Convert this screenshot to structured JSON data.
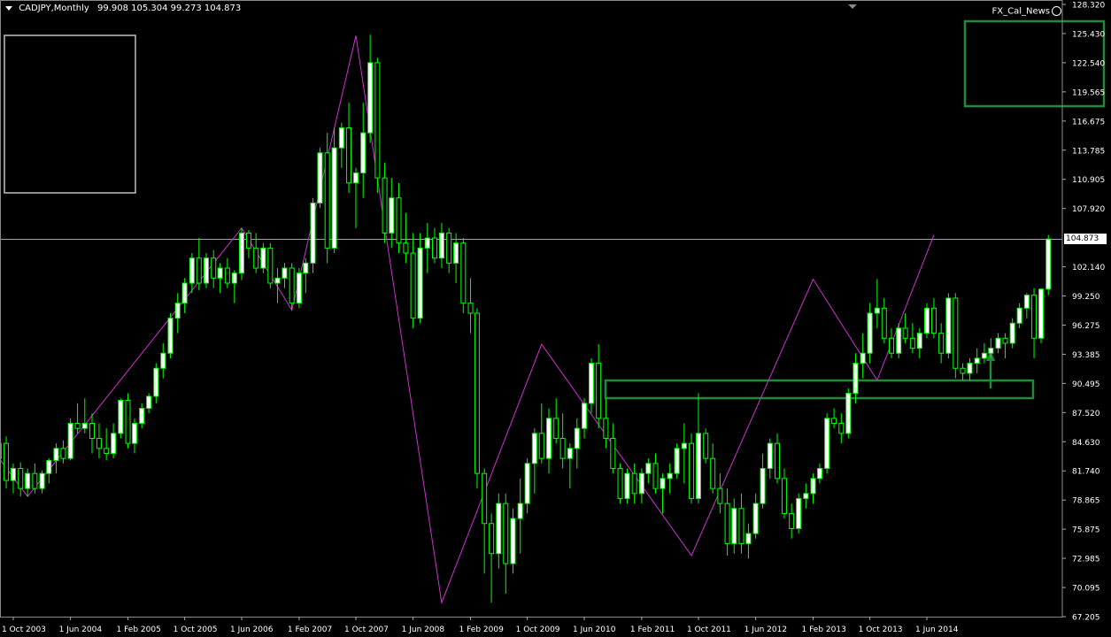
{
  "header": {
    "symbol": "CADJPY,Monthly",
    "ohlc": "99.908 105.304 99.273 104.873"
  },
  "indicator_label": "FX_Cal_News",
  "current_price_label": "104.873",
  "colors": {
    "background": "#000000",
    "candle_up_fill": "#ffffff",
    "candle_wick": "#00ff00",
    "zigzag": "#cc33cc",
    "annotation": "#1f8a3c",
    "axis_text": "#ffffff",
    "grid_line": "#a0a0b0"
  },
  "chart_data": {
    "type": "candlestick",
    "ylim": [
      67.205,
      128.32
    ],
    "y_ticks": [
      "128.320",
      "125.430",
      "122.540",
      "119.565",
      "116.675",
      "113.785",
      "110.905",
      "107.920",
      "104.873",
      "102.140",
      "99.250",
      "96.275",
      "93.385",
      "90.495",
      "87.520",
      "84.630",
      "81.740",
      "78.865",
      "75.875",
      "72.985",
      "70.095",
      "67.205"
    ],
    "x_ticks": [
      "1 Oct 2003",
      "1 Jun 2004",
      "1 Feb 2005",
      "1 Oct 2005",
      "1 Jun 2006",
      "1 Feb 2007",
      "1 Oct 2007",
      "1 Jun 2008",
      "1 Feb 2009",
      "1 Oct 2009",
      "1 Jun 2010",
      "1 Feb 2011",
      "1 Oct 2011",
      "1 Jun 2012",
      "1 Feb 2013",
      "1 Oct 2013",
      "1 Jun 2014"
    ],
    "current_price": 104.873,
    "zigzag": [
      [
        "2003-07-01",
        84.0
      ],
      [
        "2003-12-01",
        79.2
      ],
      [
        "2006-06-01",
        106.0
      ],
      [
        "2007-01-01",
        97.8
      ],
      [
        "2007-10-01",
        125.2
      ],
      [
        "2008-10-01",
        68.6
      ],
      [
        "2009-12-01",
        94.4
      ],
      [
        "2011-09-01",
        73.3
      ],
      [
        "2013-02-01",
        100.9
      ],
      [
        "2013-11-01",
        90.8
      ],
      [
        "2014-07-01",
        105.3
      ]
    ],
    "candles": [
      [
        "2003-06-01",
        83.5,
        84.9,
        82.6,
        84.3
      ],
      [
        "2003-07-01",
        84.3,
        85.0,
        82.0,
        83.0
      ],
      [
        "2003-08-01",
        83.0,
        84.8,
        81.5,
        84.5
      ],
      [
        "2003-09-01",
        84.5,
        85.2,
        80.0,
        80.8
      ],
      [
        "2003-10-01",
        80.8,
        82.5,
        79.5,
        82.0
      ],
      [
        "2003-11-01",
        82.0,
        82.6,
        79.2,
        80.0
      ],
      [
        "2003-12-01",
        80.0,
        82.0,
        79.2,
        81.5
      ],
      [
        "2004-01-01",
        81.5,
        82.5,
        79.5,
        80.0
      ],
      [
        "2004-02-01",
        80.0,
        81.8,
        79.5,
        81.5
      ],
      [
        "2004-03-01",
        81.5,
        83.0,
        80.5,
        82.8
      ],
      [
        "2004-04-01",
        82.8,
        84.5,
        81.5,
        84.0
      ],
      [
        "2004-05-01",
        84.0,
        84.8,
        82.5,
        83.0
      ],
      [
        "2004-06-01",
        83.0,
        87.0,
        82.8,
        86.5
      ],
      [
        "2004-07-01",
        86.5,
        88.5,
        85.5,
        86.0
      ],
      [
        "2004-08-01",
        86.0,
        89.0,
        85.5,
        86.5
      ],
      [
        "2004-09-01",
        86.5,
        87.5,
        83.5,
        85.0
      ],
      [
        "2004-10-01",
        85.0,
        86.5,
        83.0,
        84.0
      ],
      [
        "2004-11-01",
        84.0,
        86.0,
        82.8,
        83.5
      ],
      [
        "2004-12-01",
        83.5,
        86.5,
        83.0,
        85.5
      ],
      [
        "2005-01-01",
        85.5,
        89.0,
        85.0,
        88.8
      ],
      [
        "2005-02-01",
        88.8,
        89.5,
        84.0,
        84.5
      ],
      [
        "2005-03-01",
        84.5,
        87.0,
        83.5,
        86.5
      ],
      [
        "2005-04-01",
        86.5,
        88.5,
        86.0,
        88.0
      ],
      [
        "2005-05-01",
        88.0,
        89.5,
        87.5,
        89.2
      ],
      [
        "2005-06-01",
        89.2,
        92.5,
        88.5,
        92.0
      ],
      [
        "2005-07-01",
        92.0,
        94.5,
        91.0,
        93.5
      ],
      [
        "2005-08-01",
        93.5,
        97.5,
        93.0,
        97.0
      ],
      [
        "2005-09-01",
        97.0,
        99.5,
        95.5,
        98.5
      ],
      [
        "2005-10-01",
        98.5,
        101.0,
        97.5,
        100.5
      ],
      [
        "2005-11-01",
        100.5,
        103.5,
        99.5,
        103.0
      ],
      [
        "2005-12-01",
        103.0,
        105.0,
        99.8,
        100.5
      ],
      [
        "2006-01-01",
        100.5,
        103.5,
        100.0,
        103.0
      ],
      [
        "2006-02-01",
        103.0,
        103.8,
        100.0,
        101.0
      ],
      [
        "2006-03-01",
        101.0,
        102.5,
        99.5,
        102.0
      ],
      [
        "2006-04-01",
        102.0,
        103.0,
        100.0,
        100.5
      ],
      [
        "2006-05-01",
        100.5,
        101.8,
        98.5,
        101.5
      ],
      [
        "2006-06-01",
        101.5,
        106.0,
        100.8,
        105.5
      ],
      [
        "2006-07-01",
        105.5,
        105.8,
        103.0,
        104.0
      ],
      [
        "2006-08-01",
        104.0,
        105.5,
        101.5,
        102.0
      ],
      [
        "2006-09-01",
        102.0,
        104.5,
        101.5,
        104.0
      ],
      [
        "2006-10-01",
        104.0,
        104.5,
        100.0,
        100.5
      ],
      [
        "2006-11-01",
        100.5,
        102.0,
        98.5,
        101.0
      ],
      [
        "2006-12-01",
        101.0,
        102.5,
        100.0,
        102.0
      ],
      [
        "2007-01-01",
        102.0,
        102.5,
        97.8,
        98.5
      ],
      [
        "2007-02-01",
        98.5,
        102.0,
        98.0,
        101.5
      ],
      [
        "2007-03-01",
        101.5,
        103.0,
        99.5,
        102.5
      ],
      [
        "2007-04-01",
        102.5,
        109.0,
        101.5,
        108.5
      ],
      [
        "2007-05-01",
        108.5,
        114.0,
        108.0,
        113.5
      ],
      [
        "2007-06-01",
        113.5,
        115.5,
        102.5,
        104.0
      ],
      [
        "2007-07-01",
        104.0,
        116.0,
        103.5,
        114.0
      ],
      [
        "2007-08-01",
        114.0,
        116.5,
        112.0,
        116.0
      ],
      [
        "2007-09-01",
        116.0,
        118.5,
        109.5,
        110.5
      ],
      [
        "2007-10-01",
        110.5,
        112.0,
        106.0,
        111.5
      ],
      [
        "2007-11-01",
        111.5,
        118.5,
        109.0,
        115.5
      ],
      [
        "2007-12-01",
        115.5,
        125.3,
        114.5,
        122.5
      ],
      [
        "2008-01-01",
        122.5,
        123.0,
        109.5,
        111.0
      ],
      [
        "2008-02-01",
        111.0,
        112.5,
        104.5,
        105.5
      ],
      [
        "2008-03-01",
        105.5,
        111.0,
        104.0,
        109.0
      ],
      [
        "2008-04-01",
        109.0,
        110.5,
        103.5,
        104.5
      ],
      [
        "2008-05-01",
        104.5,
        107.5,
        102.5,
        103.5
      ],
      [
        "2008-06-01",
        103.5,
        105.5,
        96.0,
        97.0
      ],
      [
        "2008-07-01",
        97.0,
        105.5,
        96.5,
        104.0
      ],
      [
        "2008-08-01",
        104.0,
        106.5,
        101.5,
        105.0
      ],
      [
        "2008-09-01",
        105.0,
        106.0,
        102.5,
        103.0
      ],
      [
        "2008-10-01",
        103.0,
        106.5,
        102.0,
        105.5
      ],
      [
        "2008-11-01",
        105.5,
        106.0,
        101.5,
        102.5
      ],
      [
        "2008-12-01",
        102.5,
        105.5,
        100.5,
        104.5
      ],
      [
        "2009-01-01",
        104.5,
        105.0,
        97.5,
        98.5
      ],
      [
        "2009-02-01",
        98.5,
        101.0,
        95.5,
        97.5
      ],
      [
        "2009-03-01",
        97.5,
        98.0,
        80.0,
        81.5
      ],
      [
        "2009-04-01",
        81.5,
        82.0,
        71.5,
        76.5
      ],
      [
        "2009-05-01",
        76.5,
        77.5,
        68.6,
        73.5
      ],
      [
        "2009-06-01",
        73.5,
        79.5,
        72.0,
        78.5
      ],
      [
        "2009-07-01",
        78.5,
        79.5,
        69.5,
        72.5
      ],
      [
        "2009-08-01",
        72.5,
        78.0,
        71.5,
        77.0
      ],
      [
        "2009-09-01",
        77.0,
        81.0,
        73.5,
        78.5
      ],
      [
        "2009-10-01",
        78.5,
        83.0,
        77.5,
        82.5
      ],
      [
        "2009-11-01",
        82.5,
        86.0,
        79.5,
        85.5
      ],
      [
        "2009-12-01",
        85.5,
        88.5,
        82.5,
        83.0
      ],
      [
        "2010-01-01",
        83.0,
        88.0,
        81.5,
        87.0
      ],
      [
        "2010-02-01",
        87.0,
        89.0,
        84.5,
        85.0
      ],
      [
        "2010-03-01",
        85.0,
        87.5,
        82.0,
        83.0
      ],
      [
        "2010-04-01",
        83.0,
        84.5,
        80.0,
        84.0
      ],
      [
        "2010-05-01",
        84.0,
        87.0,
        82.0,
        86.0
      ],
      [
        "2010-06-01",
        86.0,
        89.0,
        85.0,
        88.5
      ],
      [
        "2010-07-01",
        88.5,
        93.0,
        87.5,
        92.5
      ],
      [
        "2010-08-01",
        92.5,
        94.4,
        86.0,
        87.0
      ],
      [
        "2010-09-01",
        87.0,
        89.0,
        84.0,
        85.0
      ],
      [
        "2010-10-01",
        85.0,
        86.5,
        81.5,
        82.0
      ],
      [
        "2010-11-01",
        82.0,
        82.5,
        78.5,
        79.0
      ],
      [
        "2010-12-01",
        79.0,
        82.0,
        78.5,
        81.5
      ],
      [
        "2011-01-01",
        81.5,
        82.5,
        78.5,
        79.5
      ],
      [
        "2011-02-01",
        79.5,
        82.0,
        78.5,
        81.5
      ],
      [
        "2011-03-01",
        81.5,
        83.0,
        80.5,
        82.5
      ],
      [
        "2011-04-01",
        82.5,
        83.5,
        79.5,
        80.0
      ],
      [
        "2011-05-01",
        80.0,
        81.5,
        77.5,
        81.0
      ],
      [
        "2011-06-01",
        81.0,
        82.5,
        79.5,
        81.5
      ],
      [
        "2011-07-01",
        81.5,
        84.5,
        81.0,
        84.0
      ],
      [
        "2011-08-01",
        84.0,
        86.5,
        80.5,
        84.5
      ],
      [
        "2011-09-01",
        84.5,
        85.5,
        78.5,
        79.0
      ],
      [
        "2011-10-01",
        79.0,
        89.5,
        78.5,
        85.5
      ],
      [
        "2011-11-01",
        85.5,
        86.0,
        82.5,
        83.0
      ],
      [
        "2011-12-01",
        83.0,
        84.5,
        79.5,
        80.0
      ],
      [
        "2012-01-01",
        80.0,
        81.5,
        77.5,
        78.5
      ],
      [
        "2012-02-01",
        78.5,
        80.0,
        73.3,
        74.5
      ],
      [
        "2012-03-01",
        74.5,
        79.0,
        73.5,
        78.0
      ],
      [
        "2012-04-01",
        78.0,
        79.5,
        73.5,
        74.5
      ],
      [
        "2012-05-01",
        74.5,
        76.5,
        73.0,
        75.5
      ],
      [
        "2012-06-01",
        75.5,
        79.5,
        75.0,
        78.5
      ],
      [
        "2012-07-01",
        78.5,
        83.5,
        78.0,
        82.0
      ],
      [
        "2012-08-01",
        82.0,
        85.0,
        81.0,
        84.5
      ],
      [
        "2012-09-01",
        84.5,
        85.5,
        80.5,
        81.0
      ],
      [
        "2012-10-01",
        81.0,
        82.0,
        77.0,
        77.5
      ],
      [
        "2012-11-01",
        77.5,
        78.5,
        75.0,
        76.0
      ],
      [
        "2012-12-01",
        76.0,
        79.5,
        75.5,
        79.0
      ],
      [
        "2013-01-01",
        79.0,
        80.5,
        78.0,
        79.5
      ],
      [
        "2013-02-01",
        79.5,
        81.5,
        78.5,
        81.0
      ],
      [
        "2013-03-01",
        81.0,
        82.5,
        80.5,
        82.0
      ],
      [
        "2013-04-01",
        82.0,
        87.5,
        81.5,
        87.0
      ],
      [
        "2013-05-01",
        87.0,
        88.0,
        86.0,
        86.5
      ],
      [
        "2013-06-01",
        86.5,
        87.5,
        84.5,
        85.5
      ],
      [
        "2013-07-01",
        85.5,
        90.0,
        85.0,
        89.5
      ],
      [
        "2013-08-01",
        89.5,
        93.5,
        88.5,
        92.5
      ],
      [
        "2013-09-01",
        92.5,
        95.5,
        91.0,
        93.5
      ],
      [
        "2013-10-01",
        93.5,
        98.5,
        92.5,
        97.5
      ],
      [
        "2013-11-01",
        97.5,
        100.9,
        96.0,
        98.0
      ],
      [
        "2013-12-01",
        98.0,
        99.0,
        94.5,
        95.0
      ],
      [
        "2014-01-01",
        95.0,
        96.0,
        93.0,
        93.5
      ],
      [
        "2014-02-01",
        93.5,
        96.5,
        93.0,
        96.0
      ],
      [
        "2014-03-01",
        96.0,
        97.5,
        94.5,
        95.0
      ],
      [
        "2014-04-01",
        95.0,
        96.5,
        93.5,
        94.0
      ],
      [
        "2014-05-01",
        94.0,
        96.0,
        93.0,
        95.5
      ],
      [
        "2014-06-01",
        95.5,
        98.5,
        95.0,
        98.0
      ],
      [
        "2014-07-01",
        98.0,
        99.0,
        95.0,
        95.5
      ],
      [
        "2014-08-01",
        95.5,
        96.5,
        92.5,
        93.5
      ],
      [
        "2014-09-01",
        93.5,
        99.5,
        93.0,
        99.0
      ],
      [
        "2014-10-01",
        99.0,
        99.5,
        91.0,
        92.0
      ],
      [
        "2014-11-01",
        92.0,
        92.5,
        90.8,
        91.5
      ],
      [
        "2014-12-01",
        91.5,
        93.0,
        90.8,
        92.5
      ],
      [
        "2015-01-01",
        92.5,
        94.0,
        91.5,
        93.0
      ],
      [
        "2015-02-01",
        93.0,
        94.5,
        92.5,
        93.5
      ],
      [
        "2015-03-01",
        93.5,
        95.0,
        93.0,
        94.0
      ],
      [
        "2015-04-01",
        94.0,
        95.5,
        93.5,
        95.0
      ],
      [
        "2015-05-01",
        95.0,
        95.5,
        93.0,
        94.5
      ],
      [
        "2015-06-01",
        94.5,
        97.0,
        94.0,
        96.5
      ],
      [
        "2015-07-01",
        96.5,
        98.5,
        96.0,
        98.0
      ],
      [
        "2015-08-01",
        98.0,
        99.5,
        97.0,
        99.3
      ],
      [
        "2015-09-01",
        99.3,
        100.0,
        93.0,
        95.0
      ],
      [
        "2015-10-01",
        95.0,
        100.0,
        94.5,
        99.9
      ],
      [
        "2015-11-01",
        99.9,
        105.3,
        99.3,
        104.9
      ]
    ]
  }
}
